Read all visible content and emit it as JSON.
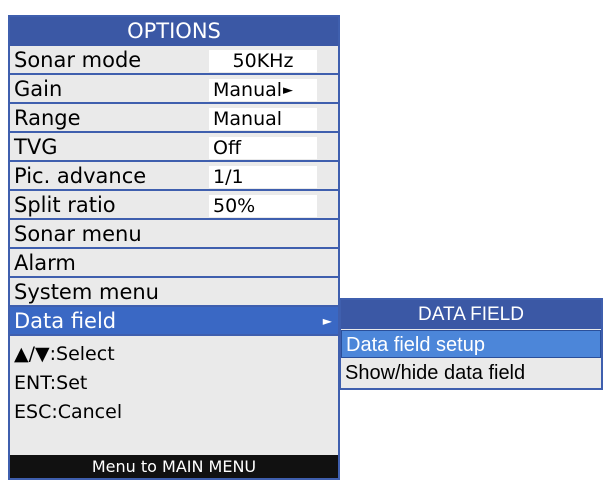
{
  "options_menu": {
    "title": "OPTIONS",
    "rows": [
      {
        "label": "Sonar mode",
        "value": "50KHz"
      },
      {
        "label": "Gain",
        "value": "Manual",
        "value_arrow": "►"
      },
      {
        "label": "Range",
        "value": "Manual"
      },
      {
        "label": "TVG",
        "value": "Off"
      },
      {
        "label": "Pic. advance",
        "value": "1/1"
      },
      {
        "label": "Split ratio",
        "value": "50%"
      },
      {
        "label": "Sonar menu"
      },
      {
        "label": "Alarm"
      },
      {
        "label": "System menu"
      },
      {
        "label": "Data field",
        "arrow": "►",
        "selected": true
      }
    ],
    "hints": {
      "select": "▲/▼:Select",
      "set": "ENT:Set",
      "cancel": "ESC:Cancel"
    },
    "footer": "Menu to MAIN MENU"
  },
  "data_field_menu": {
    "title": "DATA FIELD",
    "items": [
      {
        "label": "Data field setup",
        "selected": true
      },
      {
        "label": "Show/hide data field"
      }
    ]
  },
  "colors": {
    "title_bar": "#3b58a5",
    "selection": "#3a68c4",
    "panel_bg": "#eaeaea",
    "footer_bg": "#111111"
  }
}
